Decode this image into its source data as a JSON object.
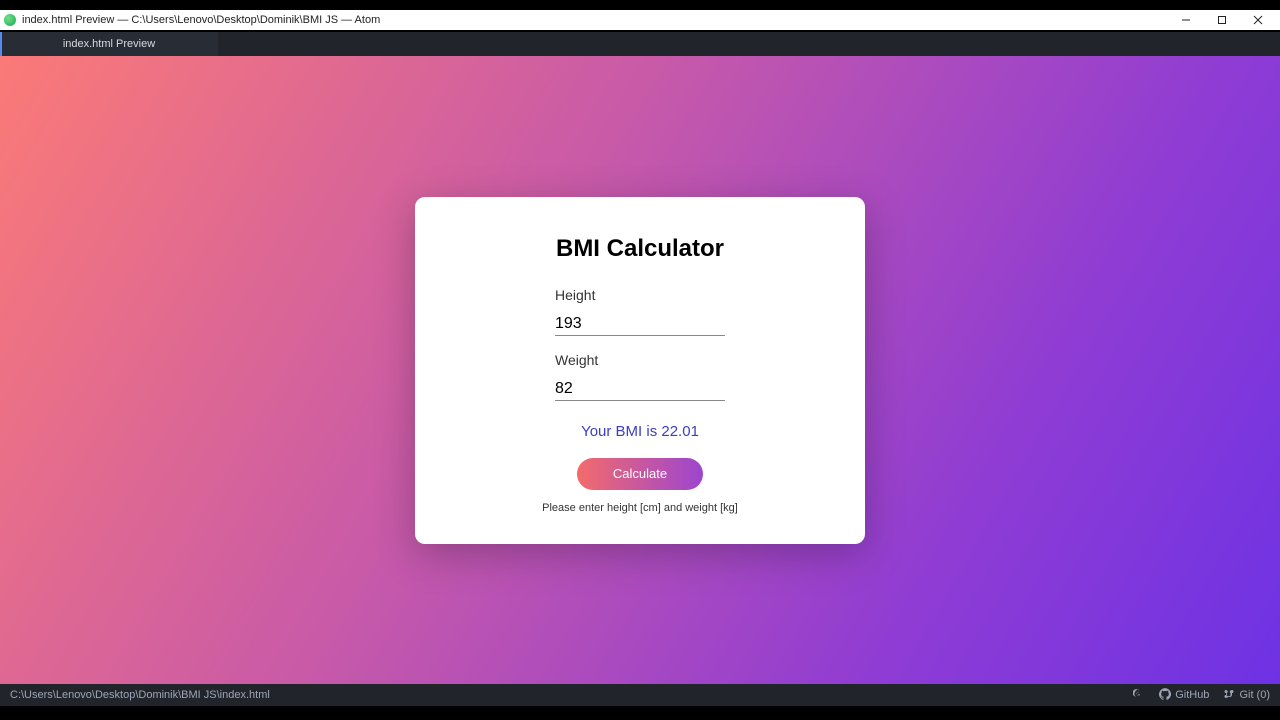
{
  "window": {
    "title": "index.html Preview — C:\\Users\\Lenovo\\Desktop\\Dominik\\BMI JS — Atom"
  },
  "tabs": {
    "active": "index.html Preview"
  },
  "calculator": {
    "title": "BMI Calculator",
    "height_label": "Height",
    "height_value": "193",
    "weight_label": "Weight",
    "weight_value": "82",
    "result": "Your BMI is 22.01",
    "button_label": "Calculate",
    "hint": "Please enter height [cm] and weight [kg]"
  },
  "status_bar": {
    "path": "C:\\Users\\Lenovo\\Desktop\\Dominik\\BMI JS\\index.html",
    "github": "GitHub",
    "git": "Git (0)"
  }
}
